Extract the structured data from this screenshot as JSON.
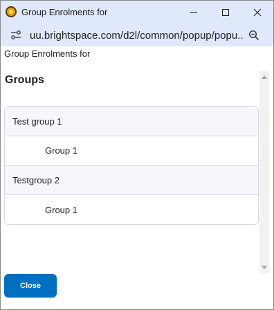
{
  "window": {
    "title": "Group Enrolments for",
    "icon": "brightspace-app-icon",
    "controls": {
      "minimize": "minimize-icon",
      "maximize": "maximize-icon",
      "close": "close-icon"
    }
  },
  "addressbar": {
    "url": "uu.brightspace.com/d2l/common/popup/popu..."
  },
  "page": {
    "header": "Group Enrolments for",
    "heading": "Groups",
    "categories": [
      {
        "name": "Test group 1",
        "groups": [
          "Group 1"
        ]
      },
      {
        "name": "Testgroup 2",
        "groups": [
          "Group 1"
        ]
      }
    ],
    "close_label": "Close"
  },
  "colors": {
    "titlebar": "#dfe9fb",
    "primary_button": "#006fbf",
    "header_row": "#f5f7fb",
    "border": "#d3d9e3"
  }
}
